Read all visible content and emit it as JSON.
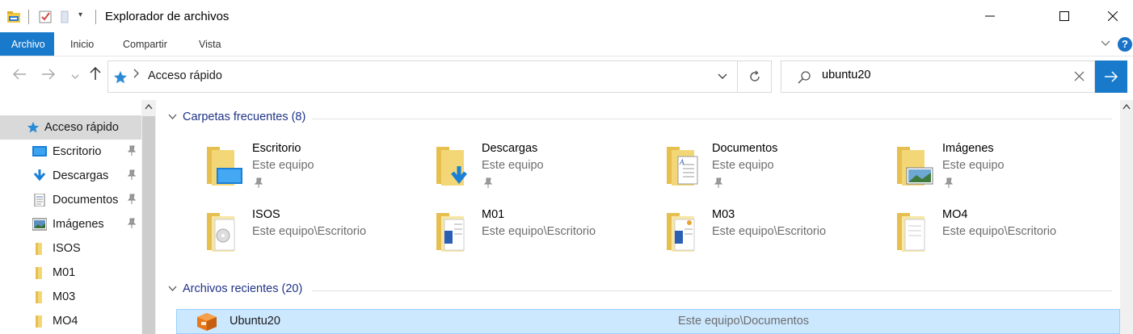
{
  "window": {
    "title": "Explorador de archivos"
  },
  "ribbon": {
    "tabs": [
      "Archivo",
      "Inicio",
      "Compartir",
      "Vista"
    ],
    "active_index": 0,
    "help": "?"
  },
  "address": {
    "breadcrumb": "Acceso rápido"
  },
  "search": {
    "value": "ubuntu20"
  },
  "nav": {
    "items": [
      {
        "label": "Acceso rápido",
        "icon": "star-icon",
        "pinned": false,
        "selected": true
      },
      {
        "label": "Escritorio",
        "icon": "desktop-icon",
        "pinned": true
      },
      {
        "label": "Descargas",
        "icon": "download-icon",
        "pinned": true
      },
      {
        "label": "Documentos",
        "icon": "documents-icon",
        "pinned": true
      },
      {
        "label": "Imágenes",
        "icon": "pictures-icon",
        "pinned": true
      },
      {
        "label": "ISOS",
        "icon": "folder-icon",
        "pinned": false
      },
      {
        "label": "M01",
        "icon": "folder-icon",
        "pinned": false
      },
      {
        "label": "M03",
        "icon": "folder-icon",
        "pinned": false
      },
      {
        "label": "MO4",
        "icon": "folder-icon",
        "pinned": false
      }
    ]
  },
  "frequent": {
    "header": "Carpetas frecuentes (8)",
    "folders": [
      {
        "name": "Escritorio",
        "location": "Este equipo",
        "pinned": true,
        "overlay": "desktop"
      },
      {
        "name": "Descargas",
        "location": "Este equipo",
        "pinned": true,
        "overlay": "download"
      },
      {
        "name": "Documentos",
        "location": "Este equipo",
        "pinned": true,
        "overlay": "document"
      },
      {
        "name": "Imágenes",
        "location": "Este equipo",
        "pinned": true,
        "overlay": "picture"
      },
      {
        "name": "ISOS",
        "location": "Este equipo\\Escritorio",
        "pinned": false,
        "overlay": "disc"
      },
      {
        "name": "M01",
        "location": "Este equipo\\Escritorio",
        "pinned": false,
        "overlay": "word"
      },
      {
        "name": "M03",
        "location": "Este equipo\\Escritorio",
        "pinned": false,
        "overlay": "word"
      },
      {
        "name": "MO4",
        "location": "Este equipo\\Escritorio",
        "pinned": false,
        "overlay": "pages"
      }
    ]
  },
  "recent": {
    "header": "Archivos recientes (20)",
    "files": [
      {
        "name": "Ubuntu20",
        "location": "Este equipo\\Documentos",
        "icon": "virtualbox-icon",
        "selected": true
      }
    ]
  },
  "colors": {
    "accent": "#1979ca",
    "selection": "#cce8ff",
    "folder": "#f3d777",
    "group_header": "#1e3287"
  }
}
